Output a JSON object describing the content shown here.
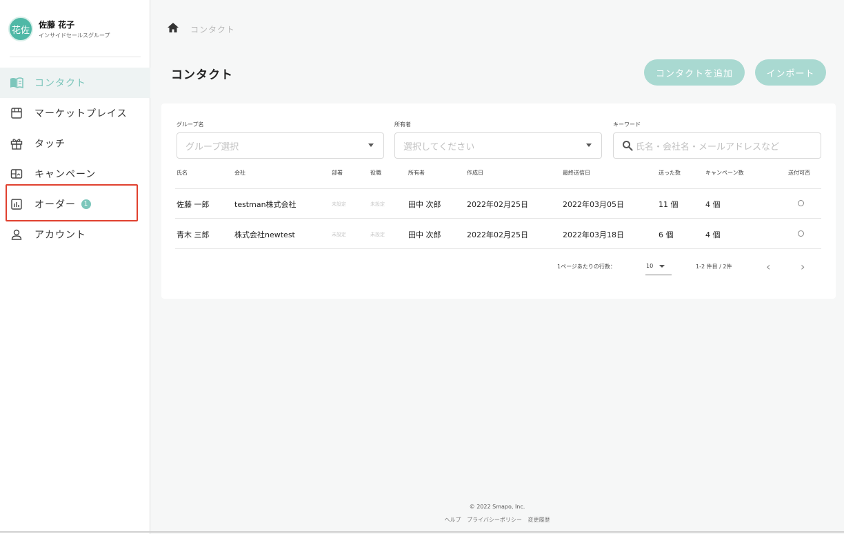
{
  "user": {
    "avatar_text": "花佐",
    "name": "佐藤 花子",
    "group": "インサイドセールスグループ"
  },
  "sidebar": {
    "items": [
      {
        "label": "コンタクト",
        "icon": "book-icon",
        "active": true
      },
      {
        "label": "マーケットプレイス",
        "icon": "store-icon"
      },
      {
        "label": "タッチ",
        "icon": "gift-icon"
      },
      {
        "label": "キャンペーン",
        "icon": "campaign-icon"
      },
      {
        "label": "オーダー",
        "icon": "chart-icon",
        "badge": "1"
      },
      {
        "label": "アカウント",
        "icon": "person-icon"
      }
    ]
  },
  "breadcrumb": {
    "label": "コンタクト"
  },
  "page": {
    "title": "コンタクト",
    "add_button": "コンタクトを追加",
    "import_button": "インポート"
  },
  "filters": {
    "group": {
      "label": "グループ名",
      "placeholder": "グループ選択"
    },
    "owner": {
      "label": "所有者",
      "placeholder": "選択してください"
    },
    "keyword": {
      "label": "キーワード",
      "placeholder": "氏名・会社名・メールアドレスなど"
    }
  },
  "table": {
    "headers": [
      "氏名",
      "会社",
      "部署",
      "役職",
      "所有者",
      "作成日",
      "最終送信日",
      "送った数",
      "キャンペーン数",
      "送付可否"
    ],
    "rows": [
      [
        "佐藤 一郎",
        "testman株式会社",
        "未設定",
        "未設定",
        "田中 次郎",
        "2022年02月25日",
        "2022年03月05日",
        "11 個",
        "4 個",
        ""
      ],
      [
        "青木 三郎",
        "株式会社newtest",
        "未設定",
        "未設定",
        "田中 次郎",
        "2022年02月25日",
        "2022年03月18日",
        "6 個",
        "4 個",
        ""
      ]
    ]
  },
  "pagination": {
    "rows_label": "1ページあたりの行数：",
    "rows_value": "10",
    "range": "1-2 件目 / 2件",
    "prev": "‹",
    "next": "›"
  },
  "footer": {
    "copyright": "© 2022 Smapo, Inc.",
    "links": [
      "ヘルプ",
      "プライバシーポリシー",
      "変更履歴"
    ]
  },
  "colors": {
    "accent": "#7cc6bb",
    "button": "#a9d9d1",
    "highlight": "#e0402e"
  }
}
